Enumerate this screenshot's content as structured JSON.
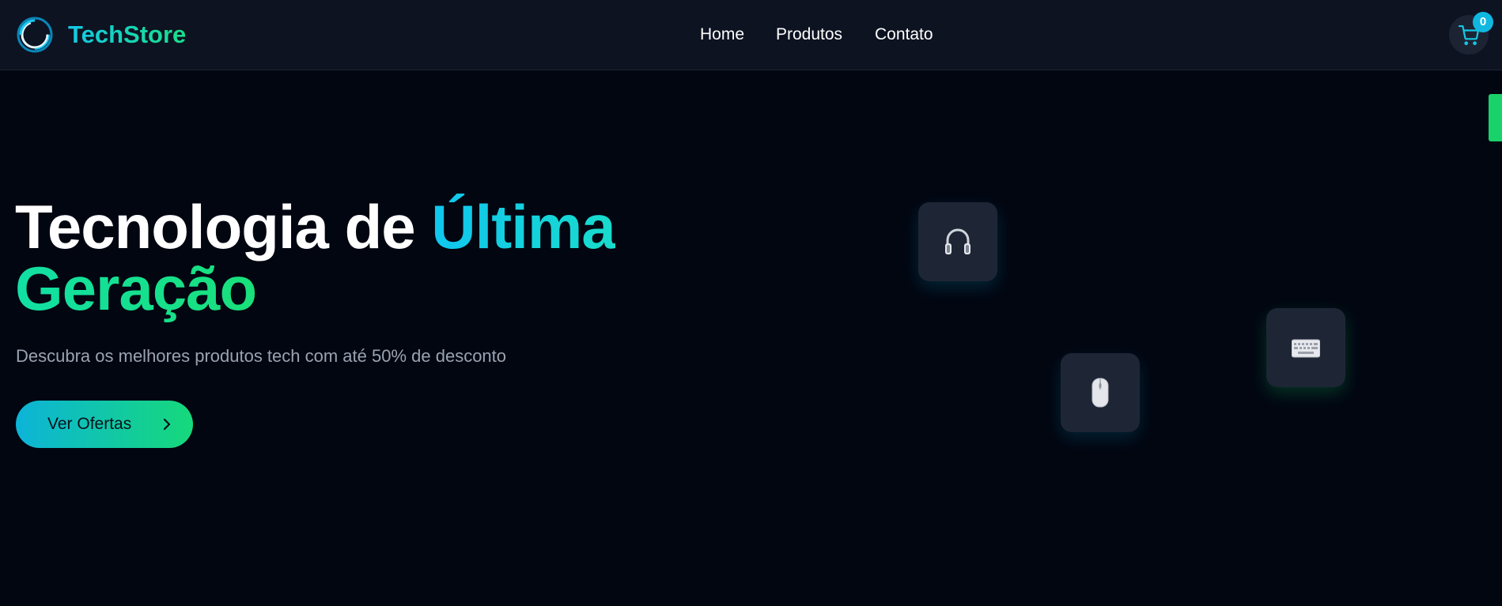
{
  "brand": {
    "name": "TechStore",
    "logo_icon": "ring-logo-icon",
    "gradient_start": "#14c8e6",
    "gradient_end": "#19e08a"
  },
  "nav": {
    "links": [
      {
        "label": "Home"
      },
      {
        "label": "Produtos"
      },
      {
        "label": "Contato"
      }
    ]
  },
  "cart": {
    "icon": "cart-icon",
    "count": "0",
    "badge_color": "#10b8e0"
  },
  "hero": {
    "title_part1": "Tecnologia de ",
    "title_part2": "Última",
    "title_part3": "Geração",
    "subtitle": "Descubra os melhores produtos tech com até 50% de desconto",
    "cta_label": "Ver Ofertas",
    "cta_icon": "chevron-right-icon"
  },
  "floating_products": [
    {
      "icon": "headphones-icon"
    },
    {
      "icon": "mouse-icon"
    },
    {
      "icon": "keyboard-icon"
    }
  ],
  "colors": {
    "background": "#020611",
    "navbar": "#0d1321",
    "card": "#1e2636",
    "accent_green": "#19d26a",
    "subtitle_text": "#9aa3b2"
  }
}
